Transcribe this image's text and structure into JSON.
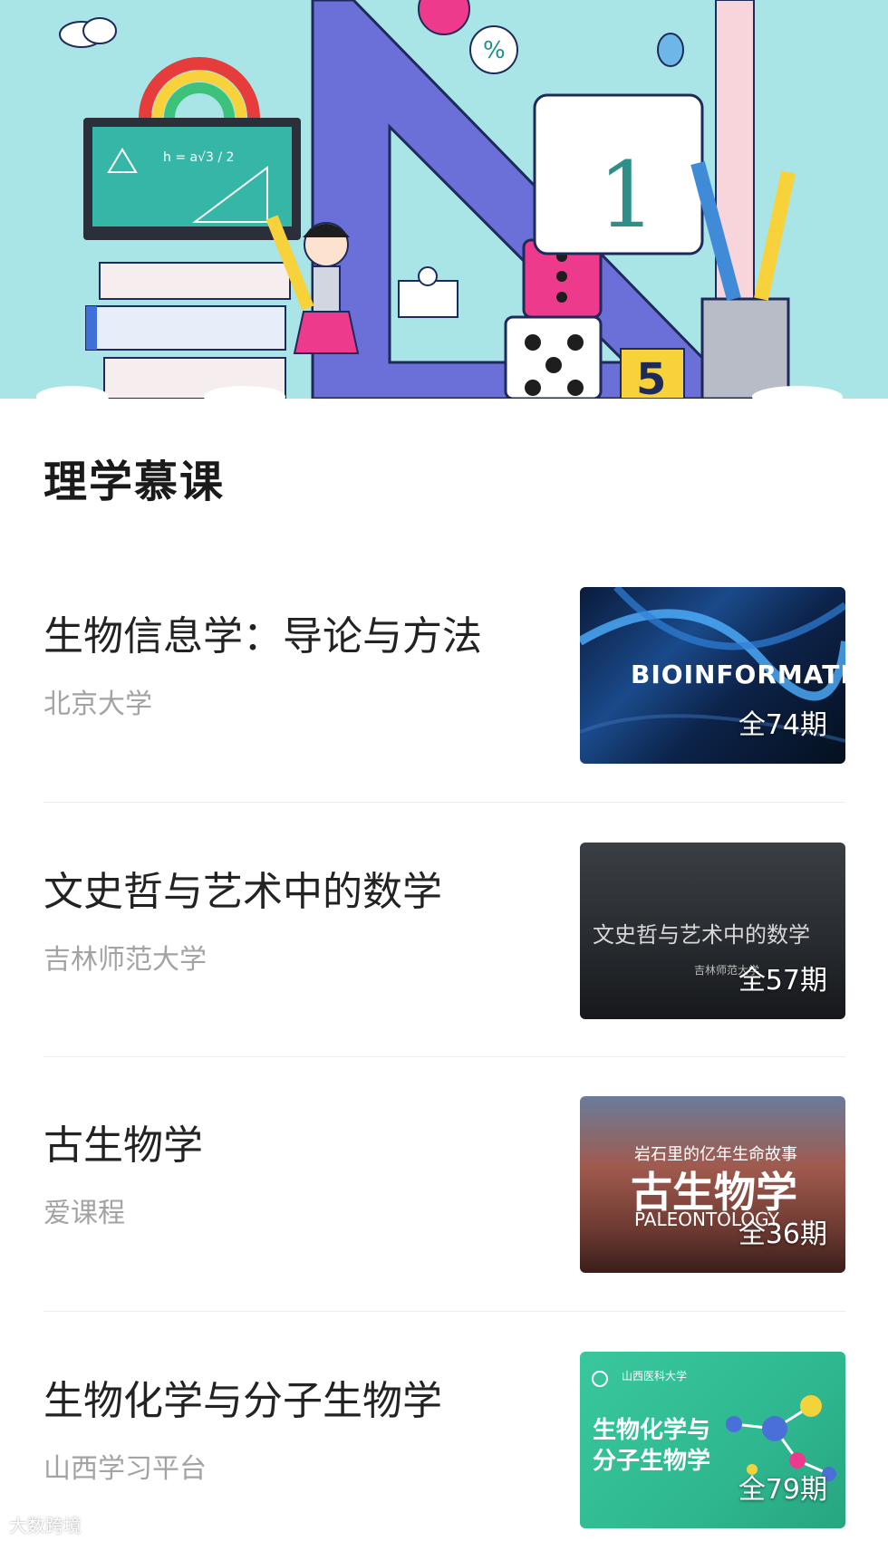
{
  "section": {
    "title": "理学慕课"
  },
  "courses": [
    {
      "title": "生物信息学：导论与方法",
      "school": "北京大学",
      "count": "全74期",
      "thumb_text": "BIOINFORMATICS"
    },
    {
      "title": "文史哲与艺术中的数学",
      "school": "吉林师范大学",
      "count": "全57期",
      "thumb_text": "文史哲与艺术中的数学",
      "thumb_sub": "吉林师范大学"
    },
    {
      "title": "古生物学",
      "school": "爱课程",
      "count": "全36期",
      "thumb_sub": "岩石里的亿年生命故事",
      "thumb_main": "古生物学",
      "thumb_en": "PALEONTOLOGY"
    },
    {
      "title": "生物化学与分子生物学",
      "school": "山西学习平台",
      "count": "全79期",
      "thumb_main": "生物化学与分子生物学",
      "thumb_head": "山西医科大学"
    }
  ],
  "watermark": "大数跨境",
  "colors": {
    "banner_bg": "#a9e5e6",
    "title": "#222222",
    "school": "#a3a3a3"
  }
}
